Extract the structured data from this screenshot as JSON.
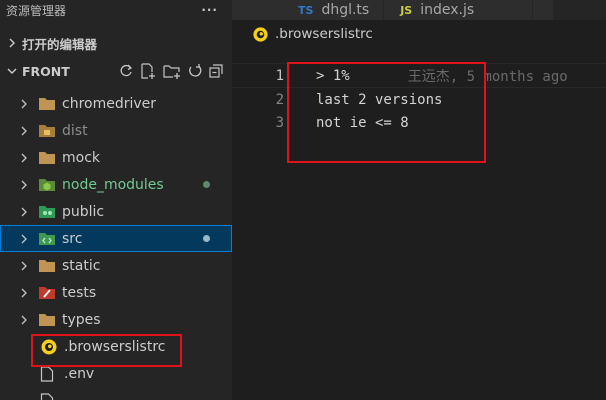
{
  "sidebar": {
    "title": "资源管理器",
    "more": "···",
    "open_editors": "打开的编辑器",
    "workspace": "FRONT",
    "items": [
      {
        "label": "chromedriver",
        "color": "#cccccc"
      },
      {
        "label": "dist",
        "color": "#8c8c8c"
      },
      {
        "label": "mock",
        "color": "#cccccc"
      },
      {
        "label": "node_modules",
        "color": "#73c991"
      },
      {
        "label": "public",
        "color": "#cccccc"
      },
      {
        "label": "src",
        "color": "#cccccc"
      },
      {
        "label": "static",
        "color": "#cccccc"
      },
      {
        "label": "tests",
        "color": "#cccccc"
      },
      {
        "label": "types",
        "color": "#cccccc"
      },
      {
        "label": ".browserslistrc",
        "color": "#cccccc"
      },
      {
        "label": ".env",
        "color": "#cccccc"
      }
    ]
  },
  "tabs": [
    {
      "badge": "TS",
      "label": "dhgl.ts",
      "badge_color": "#3178c6"
    },
    {
      "badge": "JS",
      "label": "index.js",
      "badge_color": "#cbcb41"
    }
  ],
  "editor": {
    "breadcrumb": ".browserslistrc",
    "lines": [
      {
        "num": "1",
        "text": "> 1%"
      },
      {
        "num": "2",
        "text": "last 2 versions"
      },
      {
        "num": "3",
        "text": "not ie <= 8"
      }
    ],
    "blame": "王远杰, 5 months ago"
  },
  "colors": {
    "highlight": "#e0131c",
    "selection": "#04395e",
    "modified_dot": "#73c991"
  }
}
